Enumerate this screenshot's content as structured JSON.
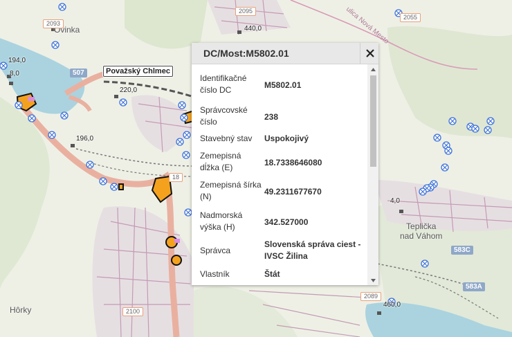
{
  "map": {
    "places": {
      "povinka": "Ovinka",
      "teplicka": "Teplička\nnad Váhom",
      "horky": "Hôrky"
    },
    "rail_label": "Považský Chlmec",
    "km_labels": [
      "194,0",
      "8,0",
      "220,0",
      "196,0",
      "440,0",
      "4,0",
      "460,0"
    ],
    "road_shields": {
      "r507": "507",
      "r583c": "583C",
      "r583a": "583A",
      "r2093": "2093",
      "r2095": "2095",
      "r2055": "2055",
      "r2089": "2089",
      "r2100": "2100",
      "r18": "18"
    },
    "street_label": "ulica Nová Mesto"
  },
  "popup": {
    "title": "DC/Most:M5802.01",
    "fields": [
      {
        "key": "Identifikačné číslo DC",
        "value": "M5802.01"
      },
      {
        "key": "Správcovské číslo",
        "value": "238"
      },
      {
        "key": "Stavebný stav",
        "value": "Uspokojivý"
      },
      {
        "key": "Zemepisná dĺžka (E)",
        "value": "18.7338646080"
      },
      {
        "key": "Zemepisná šírka (N)",
        "value": "49.2311677670"
      },
      {
        "key": "Nadmorská výška (H)",
        "value": "342.527000"
      },
      {
        "key": "Správca",
        "value": "Slovenská správa ciest - IVSC Žilina"
      },
      {
        "key": "Vlastník",
        "value": "Štát"
      }
    ]
  },
  "colors": {
    "river": "#aad3df",
    "forest": "#d8e6c8",
    "urban": "#e2dbe0",
    "street": "#b98aa8",
    "highway": "#e8a99a",
    "bridge_marker": "#3a6fd8",
    "construction": "#f4a21e"
  }
}
